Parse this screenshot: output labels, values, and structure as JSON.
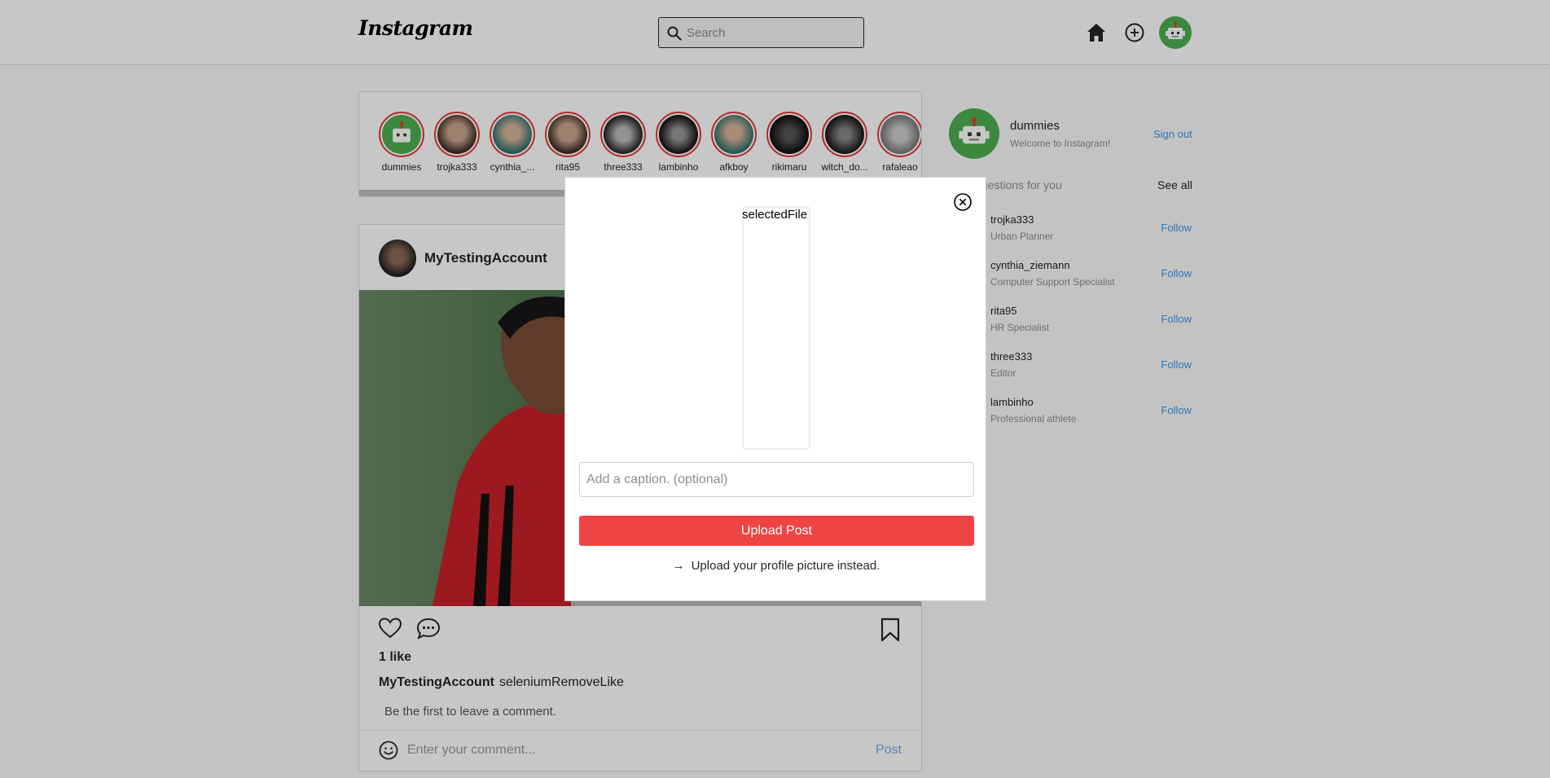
{
  "header": {
    "logo": "Instagram",
    "search_placeholder": "Search"
  },
  "stories": [
    {
      "username": "dummies"
    },
    {
      "username": "trojka333"
    },
    {
      "username": "cynthia_..."
    },
    {
      "username": "rita95"
    },
    {
      "username": "three333"
    },
    {
      "username": "lambinho"
    },
    {
      "username": "afkboy"
    },
    {
      "username": "rikimaru"
    },
    {
      "username": "witch_do..."
    },
    {
      "username": "rafaleao"
    }
  ],
  "post": {
    "username": "MyTestingAccount",
    "likes": "1 like",
    "caption_user": "MyTestingAccount",
    "caption_text": "seleniumRemoveLike",
    "no_comments": "Be the first to leave a comment.",
    "comment_placeholder": "Enter your comment...",
    "post_button": "Post"
  },
  "sidebar": {
    "username": "dummies",
    "welcome": "Welcome to Instagram!",
    "sign_out": "Sign out",
    "suggestions_title": "Suggestions for you",
    "see_all": "See all",
    "suggestions": [
      {
        "name": "trojka333",
        "role": "Urban Planner",
        "action": "Follow"
      },
      {
        "name": "cynthia_ziemann",
        "role": "Computer Support Specialist",
        "action": "Follow"
      },
      {
        "name": "rita95",
        "role": "HR Specialist",
        "action": "Follow"
      },
      {
        "name": "three333",
        "role": "Editor",
        "action": "Follow"
      },
      {
        "name": "lambinho",
        "role": "Professional athlete",
        "action": "Follow"
      }
    ]
  },
  "modal": {
    "preview_alt": "selectedFile",
    "caption_placeholder": "Add a caption. (optional)",
    "upload_button": "Upload Post",
    "alt_link": "Upload your profile picture instead."
  },
  "colors": {
    "accent_red": "#ef4444",
    "link_blue": "#3897f0",
    "avatar_green": "#4caf50"
  }
}
